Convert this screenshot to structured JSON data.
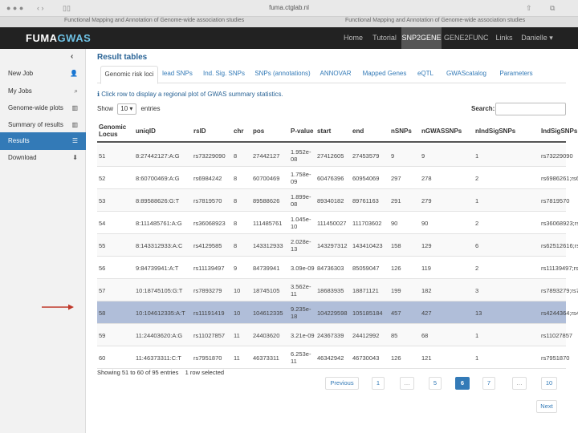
{
  "browser": {
    "url": "fuma.ctglab.nl",
    "tab_left": "Functional Mapping and Annotation of Genome-wide association studies",
    "tab_right": "Functional Mapping and Annotation of Genome-wide association studies"
  },
  "navbar": {
    "logo_main": "FUMA",
    "logo_accent": "GWAS",
    "items": [
      "Home",
      "Tutorial",
      "SNP2GENE",
      "GENE2FUNC",
      "Links",
      "Danielle ▾"
    ],
    "active_item": "SNP2GENE"
  },
  "sidebar": {
    "collapse": "‹",
    "items": [
      {
        "label": "New Job",
        "icon": "user-icon",
        "glyph": "👤"
      },
      {
        "label": "My Jobs",
        "icon": "search-icon",
        "glyph": "⌕"
      },
      {
        "label": "Genome-wide plots",
        "icon": "bar-chart-icon",
        "glyph": "▥"
      },
      {
        "label": "Summary of results",
        "icon": "bar-chart-icon",
        "glyph": "▥"
      },
      {
        "label": "Results",
        "icon": "list-icon",
        "glyph": "☰"
      },
      {
        "label": "Download",
        "icon": "download-icon",
        "glyph": "⬇"
      }
    ],
    "active_item": "Results"
  },
  "main": {
    "title": "Result tables",
    "tabs": [
      "Genomic risk loci",
      "lead SNPs",
      "Ind. Sig. SNPs",
      "SNPs (annotations)",
      "ANNOVAR",
      "Mapped Genes",
      "eQTL",
      "GWAScatalog",
      "Parameters"
    ],
    "active_tab": "Genomic risk loci",
    "hint": "ℹ Click row to display a regional plot of GWAS summary statistics.",
    "show_prefix": "Show",
    "show_value": "10",
    "show_suffix": "entries",
    "search_label": "Search:",
    "search_value": ""
  },
  "table": {
    "columns": [
      "Genomic Locus",
      "uniqID",
      "rsID",
      "chr",
      "pos",
      "P-value",
      "start",
      "end",
      "nSNPs",
      "nGWASSNPs",
      "nIndSigSNPs",
      "IndSigSNPs"
    ],
    "rows": [
      [
        "51",
        "8:27442127:A:G",
        "rs73229090",
        "8",
        "27442127",
        "1.952e-08",
        "27412605",
        "27453579",
        "9",
        "9",
        "1",
        "rs73229090"
      ],
      [
        "52",
        "8:60700469:A:G",
        "rs6984242",
        "8",
        "60700469",
        "1.758e-09",
        "60476396",
        "60954069",
        "297",
        "278",
        "2",
        "rs6986261;rs6"
      ],
      [
        "53",
        "8:89588626:G:T",
        "rs7819570",
        "8",
        "89588626",
        "1.899e-08",
        "89340182",
        "89761163",
        "291",
        "279",
        "1",
        "rs7819570"
      ],
      [
        "54",
        "8:111485761:A:G",
        "rs36068923",
        "8",
        "111485761",
        "1.045e-10",
        "111450027",
        "111703602",
        "90",
        "90",
        "2",
        "rs36068923;rs"
      ],
      [
        "55",
        "8:143312933:A:C",
        "rs4129585",
        "8",
        "143312933",
        "2.028e-13",
        "143297312",
        "143410423",
        "158",
        "129",
        "6",
        "rs62512616;rs"
      ],
      [
        "56",
        "9:84739941:A:T",
        "rs11139497",
        "9",
        "84739941",
        "3.09e-09",
        "84736303",
        "85059047",
        "126",
        "119",
        "2",
        "rs11139497;rs"
      ],
      [
        "57",
        "10:18745105:G:T",
        "rs7893279",
        "10",
        "18745105",
        "3.562e-11",
        "18683935",
        "18871121",
        "199",
        "182",
        "3",
        "rs7893279;rs7"
      ],
      [
        "58",
        "10:104612335:A:T",
        "rs11191419",
        "10",
        "104612335",
        "9.235e-18",
        "104229598",
        "105185184",
        "457",
        "427",
        "13",
        "rs4244364;rs4"
      ],
      [
        "59",
        "11:24403620:A:G",
        "rs11027857",
        "11",
        "24403620",
        "3.21e-09",
        "24367339",
        "24412992",
        "85",
        "68",
        "1",
        "rs11027857"
      ],
      [
        "60",
        "11:46373311:C:T",
        "rs7951870",
        "11",
        "46373311",
        "6.253e-11",
        "46342942",
        "46730043",
        "126",
        "121",
        "1",
        "rs7951870"
      ]
    ],
    "selected_row": "58"
  },
  "footer": {
    "info": "Showing 51 to 60 of 95 entries",
    "selected_info": "1 row selected",
    "pagination": [
      "Previous",
      "1",
      "…",
      "5",
      "6",
      "7",
      "…",
      "10"
    ],
    "next": "Next",
    "active_page": "6"
  },
  "colors": {
    "navbar_bg": "#222222",
    "primary": "#337ab7",
    "selected_row": "#b0bed9",
    "arrow": "#c0392b"
  }
}
